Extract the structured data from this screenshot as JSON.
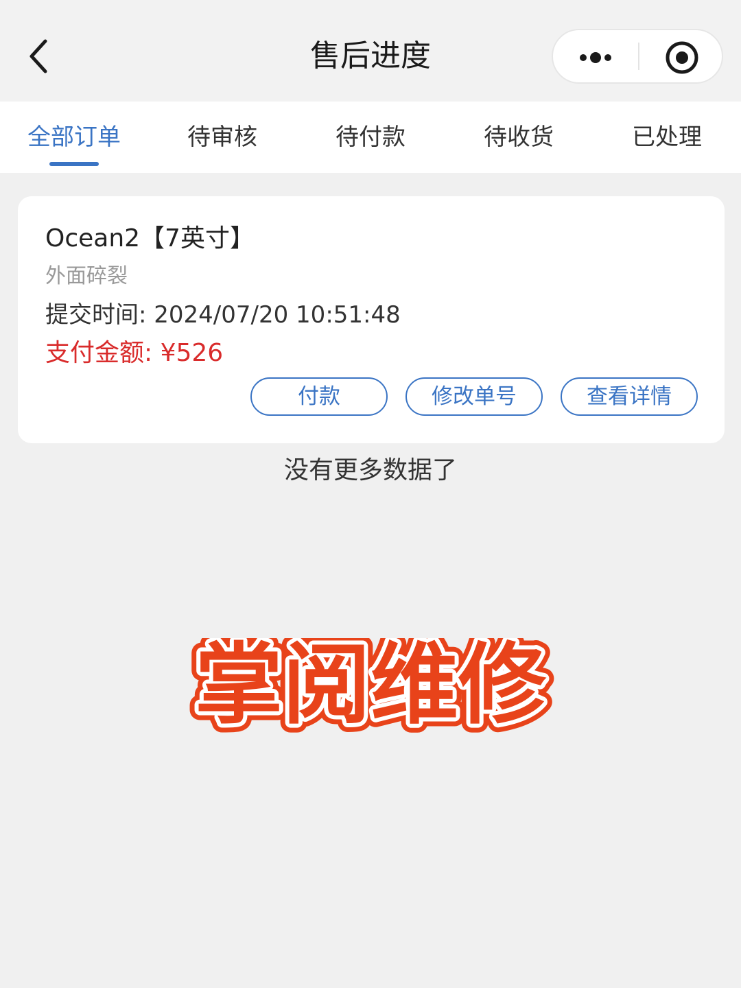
{
  "header": {
    "title": "售后进度"
  },
  "tabs": [
    {
      "label": "全部订单",
      "active": true
    },
    {
      "label": "待审核",
      "active": false
    },
    {
      "label": "待付款",
      "active": false
    },
    {
      "label": "待收货",
      "active": false
    },
    {
      "label": "已处理",
      "active": false
    }
  ],
  "order": {
    "product": "Ocean2【7英寸】",
    "fault": "外面碎裂",
    "submit_label": "提交时间:",
    "submit_time": "2024/07/20 10:51:48",
    "pay_label": "支付金额:",
    "pay_amount": "¥526",
    "buttons": {
      "pay": "付款",
      "modify": "修改单号",
      "detail": "查看详情"
    }
  },
  "footer": {
    "no_more": "没有更多数据了"
  },
  "watermark": {
    "text": "掌阅维修"
  },
  "icons": {
    "back": "chevron-left-icon",
    "more": "more-dots-icon",
    "close": "target-circle-icon"
  },
  "colors": {
    "accent": "#3a74c4",
    "price": "#d92b2b",
    "watermark_fill": "#e8431a"
  }
}
